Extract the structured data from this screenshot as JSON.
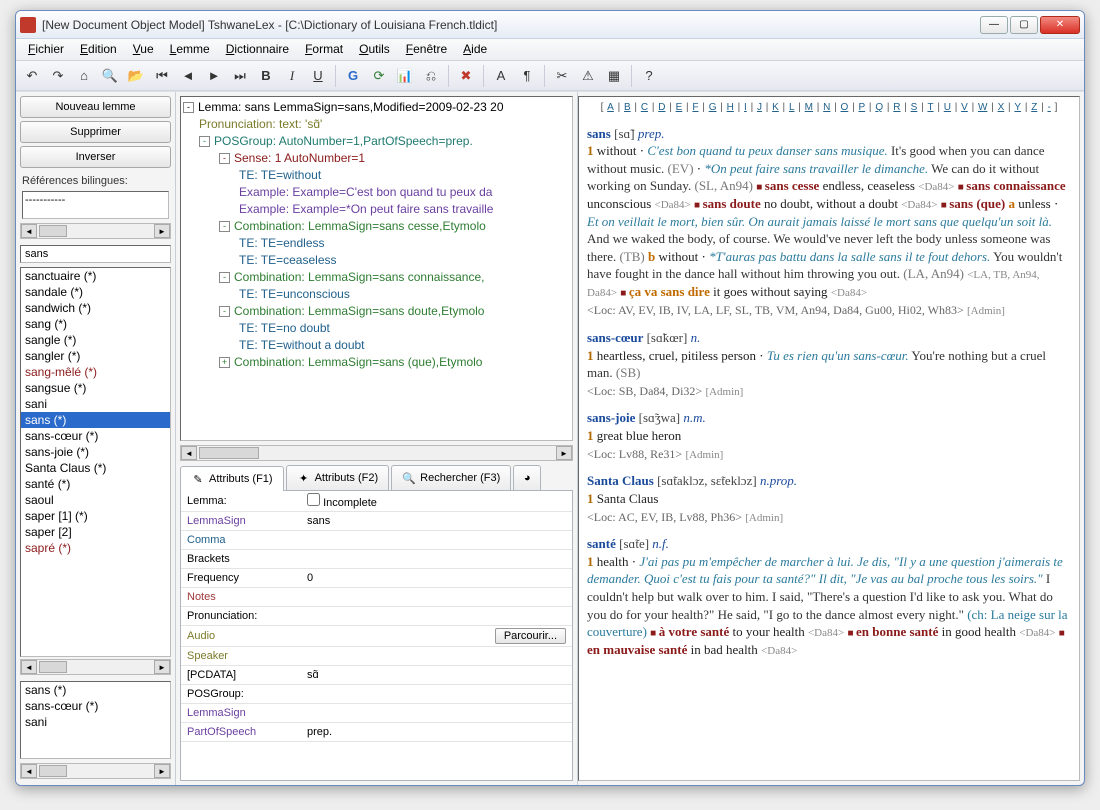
{
  "title": "[New Document Object Model] TshwaneLex - [C:\\Dictionary of Louisiana French.tldict]",
  "menus": [
    "Fichier",
    "Edition",
    "Vue",
    "Lemme",
    "Dictionnaire",
    "Format",
    "Outils",
    "Fenêtre",
    "Aide"
  ],
  "toolbar_icons": [
    "back",
    "forward",
    "home",
    "search",
    "open",
    "begin",
    "prev",
    "next",
    "end",
    "bold",
    "italic",
    "underline",
    "sep",
    "google",
    "refresh",
    "chart",
    "stats",
    "sep",
    "delete",
    "sep",
    "font",
    "pilcrow",
    "sep",
    "cut",
    "warn",
    "table",
    "sep",
    "help"
  ],
  "left": {
    "buttons": {
      "new": "Nouveau lemme",
      "delete": "Supprimer",
      "invert": "Inverser"
    },
    "refs_label": "Références bilingues:",
    "refs_content": "-----------",
    "search_value": "sans",
    "lemmas": [
      {
        "t": "sanctuaire (*)"
      },
      {
        "t": "sandale (*)"
      },
      {
        "t": "sandwich (*)"
      },
      {
        "t": "sang (*)"
      },
      {
        "t": "sangle (*)"
      },
      {
        "t": "sangler (*)"
      },
      {
        "t": "sang-mêlé (*)",
        "c": "maroon"
      },
      {
        "t": "sangsue (*)"
      },
      {
        "t": "sani"
      },
      {
        "t": "sans (*)",
        "sel": true
      },
      {
        "t": "sans-cœur (*)"
      },
      {
        "t": "sans-joie (*)"
      },
      {
        "t": "Santa Claus (*)"
      },
      {
        "t": "santé (*)"
      },
      {
        "t": "saoul"
      },
      {
        "t": "saper [1] (*)"
      },
      {
        "t": "saper [2]"
      },
      {
        "t": "sapré (*)",
        "c": "maroon"
      }
    ],
    "small": [
      "sans (*)",
      "sans-cœur (*)",
      "sani"
    ]
  },
  "tree": [
    {
      "lvl": 0,
      "tog": "-",
      "cls": "",
      "t": "Lemma: sans  LemmaSign=sans,Modified=2009-02-23 20"
    },
    {
      "lvl": 1,
      "cls": "n-olive",
      "t": "Pronunciation: text: 'sɑ̃'"
    },
    {
      "lvl": 1,
      "tog": "-",
      "cls": "n-teal",
      "t": "POSGroup:  AutoNumber=1,PartOfSpeech=prep."
    },
    {
      "lvl": 2,
      "tog": "-",
      "cls": "n-maroon",
      "t": "Sense: 1  AutoNumber=1"
    },
    {
      "lvl": 3,
      "cls": "n-blue",
      "t": "TE:  TE=without"
    },
    {
      "lvl": 3,
      "cls": "n-purple",
      "t": "Example:  Example=C'est bon quand tu peux da"
    },
    {
      "lvl": 3,
      "cls": "n-purple",
      "t": "Example:  Example=*On peut faire sans travaille"
    },
    {
      "lvl": 2,
      "tog": "-",
      "cls": "n-green",
      "t": "Combination:  LemmaSign=sans cesse,Etymolo"
    },
    {
      "lvl": 3,
      "cls": "n-blue",
      "t": "TE:  TE=endless"
    },
    {
      "lvl": 3,
      "cls": "n-blue",
      "t": "TE:  TE=ceaseless"
    },
    {
      "lvl": 2,
      "tog": "-",
      "cls": "n-green",
      "t": "Combination:  LemmaSign=sans connaissance,"
    },
    {
      "lvl": 3,
      "cls": "n-blue",
      "t": "TE:  TE=unconscious"
    },
    {
      "lvl": 2,
      "tog": "-",
      "cls": "n-green",
      "t": "Combination:  LemmaSign=sans doute,Etymolo"
    },
    {
      "lvl": 3,
      "cls": "n-blue",
      "t": "TE:  TE=no doubt"
    },
    {
      "lvl": 3,
      "cls": "n-blue",
      "t": "TE:  TE=without a doubt"
    },
    {
      "lvl": 2,
      "tog": "+",
      "cls": "n-green",
      "t": "Combination:  LemmaSign=sans (que),Etymolo"
    }
  ],
  "tabs": {
    "t1": "Attributs (F1)",
    "t2": "Attributs (F2)",
    "t3": "Rechercher (F3)"
  },
  "attrs": {
    "lemma_label": "Lemma:",
    "incomplete": "Incomplete",
    "rows": [
      {
        "k": "LemmaSign",
        "kc": "purple",
        "v": "sans"
      },
      {
        "k": "Comma",
        "kc": "blue",
        "v": ""
      },
      {
        "k": "Brackets",
        "kc": "",
        "v": ""
      },
      {
        "k": "Frequency",
        "kc": "",
        "v": "0"
      },
      {
        "k": "Notes",
        "kc": "maroon",
        "v": ""
      }
    ],
    "pron_label": "Pronunciation:",
    "audio_row": {
      "k": "Audio",
      "btn": "Parcourir..."
    },
    "speaker": "Speaker",
    "pcdata_k": "[PCDATA]",
    "pcdata_v": "sɑ̃",
    "posgroup": "POSGroup:",
    "lemsign": "LemmaSign",
    "partofspeech_k": "PartOfSpeech",
    "partofspeech_v": "prep."
  },
  "alpha": [
    "A",
    "B",
    "C",
    "D",
    "E",
    "F",
    "G",
    "H",
    "I",
    "J",
    "K",
    "L",
    "M",
    "N",
    "O",
    "P",
    "Q",
    "R",
    "S",
    "T",
    "U",
    "V",
    "W",
    "X",
    "Y",
    "Z",
    "-"
  ],
  "entries": {
    "sans": {
      "hw": "sans",
      "pron": "[sɑ̃]",
      "pos": "prep.",
      "sense": "1",
      "gloss": "without",
      "ex1": "C'est bon quand tu peux danser sans musique.",
      "tr1": "It's good when you can dance without music.",
      "s1": "(EV)",
      "ex2": "*On peut faire sans travailler le dimanche.",
      "tr2": "We can do it without working on Sunday.",
      "s2": "(SL, An94)",
      "c1": "sans cesse",
      "c1g": "endless, ceaseless",
      "c1r": "<Da84>",
      "c2": "sans connaissance",
      "c2g": "unconscious",
      "c2r": "<Da84>",
      "c3": "sans doute",
      "c3g": "no doubt, without a doubt",
      "c3r": "<Da84>",
      "c4": "sans (que)",
      "c4ga": "a",
      "c4g": "unless",
      "ex3": "Et on veillait le mort, bien sûr. On aurait jamais laissé le mort sans que quelqu'un soit là.",
      "tr3": "And we waked the body, of course. We would've never left the body unless someone was there.",
      "s3": "(TB)",
      "c4gb": "b",
      "c4g2": "without",
      "ex4": "*T'auras pas battu dans la salle sans il te fout dehors.",
      "tr4": "You wouldn't have fought in the dance hall without him throwing you out.",
      "s4": "(LA, An94)",
      "r4": "<LA, TB, An94, Da84>",
      "c5": "ça va sans dire",
      "c5g": "it goes without saying",
      "c5r": "<Da84>",
      "loc": "<Loc: AV, EV, IB, IV, LA, LF, SL, TB, VM, An94, Da84, Gu00, Hi02, Wh83>",
      "admin": "[Admin]"
    },
    "sanscoeur": {
      "hw": "sans-cœur",
      "pron": "[sɑ̃kœr]",
      "pos": "n.",
      "sense": "1",
      "gloss": "heartless, cruel, pitiless person",
      "ex1": "Tu es rien qu'un sans-cœur.",
      "tr1": "You're nothing but a cruel man.",
      "s1": "(SB)",
      "loc": "<Loc: SB, Da84, Di32>",
      "admin": "[Admin]"
    },
    "sansjoie": {
      "hw": "sans-joie",
      "pron": "[sɑ̃ʒwa]",
      "pos": "n.m.",
      "sense": "1",
      "gloss": "great blue heron",
      "loc": "<Loc: Lv88, Re31>",
      "admin": "[Admin]"
    },
    "santa": {
      "hw": "Santa Claus",
      "pron": "[sɑ̃taklɔz, sɛ̃teklɔz]",
      "pos": "n.prop.",
      "sense": "1",
      "gloss": "Santa Claus",
      "loc": "<Loc: AC, EV, IB, Lv88, Ph36>",
      "admin": "[Admin]"
    },
    "sante": {
      "hw": "santé",
      "pron": "[sɑ̃te]",
      "pos": "n.f.",
      "sense": "1",
      "gloss": "health",
      "ex1": "J'ai pas pu m'empêcher de marcher à lui. Je dis, \"Il y a une question j'aimerais te demander. Quoi c'est tu fais pour ta santé?\" Il dit, \"Je vas au bal proche tous les soirs.\"",
      "tr1": "I couldn't help but walk over to him. I said, \"There's a question I'd like to ask you. What do you do for your health?\" He said, \"I go to the dance almost every night.\"",
      "ch": "(ch: La neige sur la couverture)",
      "c1": "à votre santé",
      "c1g": "to your health",
      "c1r": "<Da84>",
      "c2": "en bonne santé",
      "c2g": "in good health",
      "c2r": "<Da84>",
      "c3": "en mauvaise santé",
      "c3g": "in bad health",
      "c3r": "<Da84>"
    }
  }
}
